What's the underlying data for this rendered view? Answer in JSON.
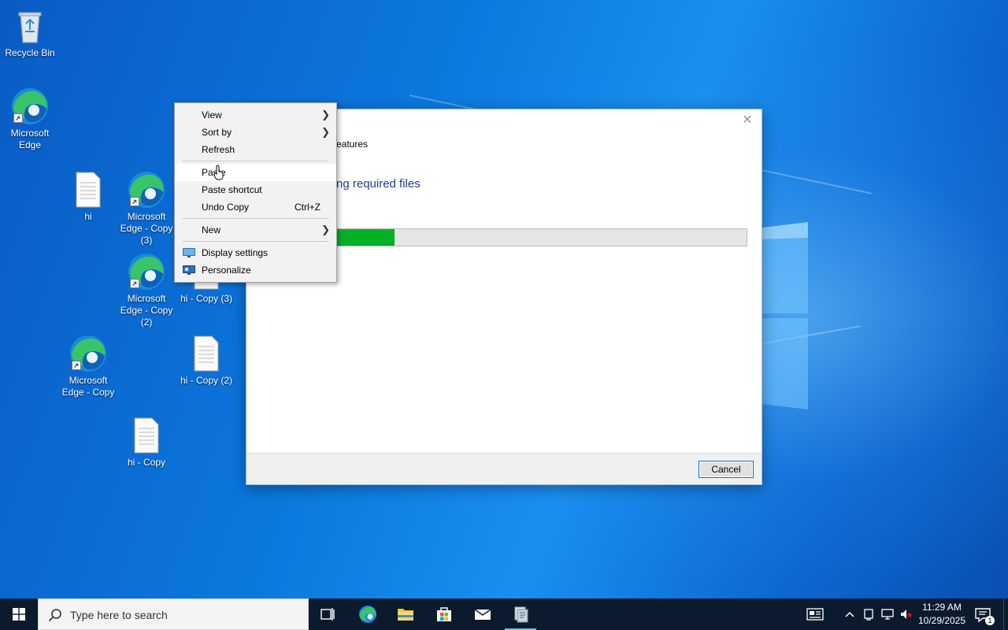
{
  "desktop": {
    "icons": [
      {
        "label": "Recycle Bin"
      },
      {
        "label": "Microsoft Edge"
      },
      {
        "label": "hi"
      },
      {
        "label": "Microsoft Edge - Copy (3)"
      },
      {
        "label": "Microsoft Edge - Copy (2)"
      },
      {
        "label": "hi - Copy (3)"
      },
      {
        "label": "Microsoft Edge - Copy"
      },
      {
        "label": "hi - Copy (2)"
      },
      {
        "label": "hi - Copy"
      }
    ]
  },
  "dialog": {
    "title": "eatures",
    "heading": "ng required files",
    "progress": 0.26,
    "cancel_label": "Cancel",
    "close_glyph": "✕"
  },
  "context_menu": {
    "items": [
      {
        "label": "View",
        "submenu": true
      },
      {
        "label": "Sort by",
        "submenu": true
      },
      {
        "label": "Refresh"
      },
      {
        "label": "Paste"
      },
      {
        "label": "Paste shortcut"
      },
      {
        "label": "Undo Copy",
        "shortcut": "Ctrl+Z"
      },
      {
        "label": "New",
        "submenu": true
      },
      {
        "label": "Display settings",
        "icon": "display-icon"
      },
      {
        "label": "Personalize",
        "icon": "personalize-icon"
      }
    ],
    "submenu_arrow": "❯"
  },
  "taskbar": {
    "search_placeholder": "Type here to search",
    "time": "11:29 AM",
    "date": "10/29/2025",
    "notification_count": "1",
    "pinned": [
      "task-view-icon",
      "edge-icon",
      "file-explorer-icon",
      "store-icon",
      "mail-icon",
      "setup-app-icon"
    ]
  },
  "colors": {
    "accent": "#0078d7",
    "progress_fill": "#06b025",
    "taskbar": "#0c1a2e"
  }
}
